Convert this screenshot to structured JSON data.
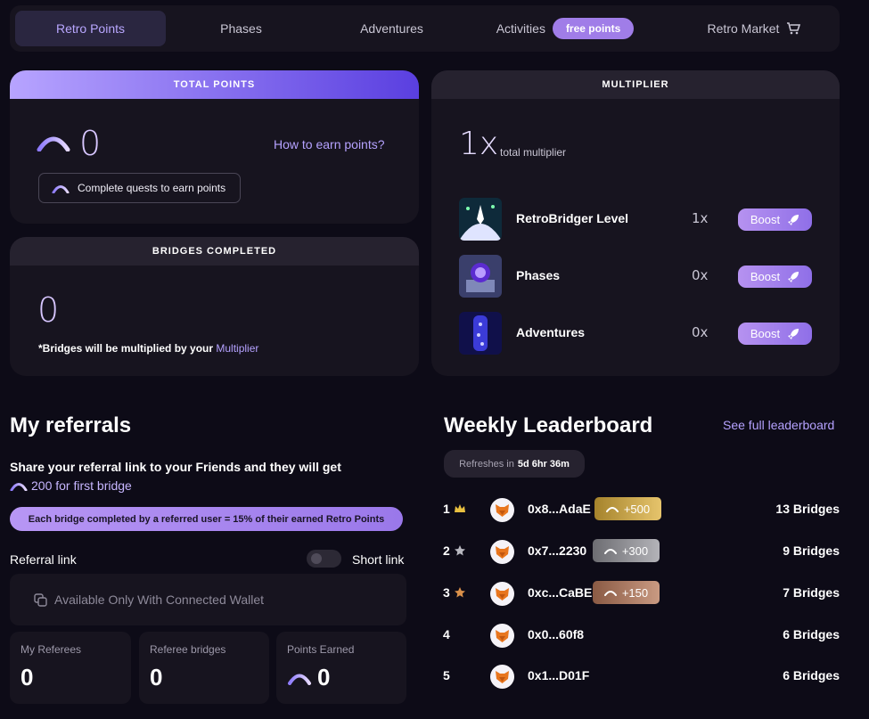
{
  "nav": {
    "items": [
      {
        "label": "Retro Points",
        "active": true
      },
      {
        "label": "Phases"
      },
      {
        "label": "Adventures"
      },
      {
        "label": "Activities",
        "pill": "free points"
      },
      {
        "label": "Retro Market",
        "icon": "cart-icon"
      }
    ]
  },
  "total_points": {
    "header": "TOTAL POINTS",
    "value": "0",
    "how_to_earn": "How to earn points?",
    "quest_button": "Complete quests to earn points"
  },
  "bridges_completed": {
    "header": "BRIDGES COMPLETED",
    "value": "0",
    "note_prefix": "*Bridges will be multiplied by your ",
    "note_link": "Multiplier"
  },
  "multiplier": {
    "header": "MULTIPLIER",
    "value": "1x",
    "label": "total multiplier",
    "rows": [
      {
        "name": "RetroBridger Level",
        "value": "1x",
        "button": "Boost"
      },
      {
        "name": "Phases",
        "value": "0x",
        "button": "Boost"
      },
      {
        "name": "Adventures",
        "value": "0x",
        "button": "Boost"
      }
    ]
  },
  "referrals": {
    "title": "My referrals",
    "share_text": "Share your referral link to your Friends and they will get",
    "bonus_text": "200 for first bridge",
    "banner": "Each bridge completed by a referred user = 15% of their earned Retro Points",
    "link_label": "Referral link",
    "short_link_label": "Short link",
    "wallet_text": "Available Only With Connected Wallet",
    "stats": [
      {
        "label": "My Referees",
        "value": "0"
      },
      {
        "label": "Referee bridges",
        "value": "0"
      },
      {
        "label": "Points Earned",
        "value": "0"
      }
    ]
  },
  "leaderboard": {
    "title": "Weekly Leaderboard",
    "see_full": "See full leaderboard",
    "refresh_label": "Refreshes in",
    "refresh_time": "5d 6hr 36m",
    "rows": [
      {
        "rank": "1",
        "address": "0x8...AdaE",
        "points": "+500",
        "bridges": "13 Bridges",
        "tier": "gold"
      },
      {
        "rank": "2",
        "address": "0x7...2230",
        "points": "+300",
        "bridges": "9 Bridges",
        "tier": "silver"
      },
      {
        "rank": "3",
        "address": "0xc...CaBE",
        "points": "+150",
        "bridges": "7 Bridges",
        "tier": "bronze"
      },
      {
        "rank": "4",
        "address": "0x0...60f8",
        "bridges": "6 Bridges"
      },
      {
        "rank": "5",
        "address": "0x1...D01F",
        "bridges": "6 Bridges"
      }
    ]
  },
  "colors": {
    "accent": "#a07de8",
    "background": "#0d0b17",
    "card": "#17141f",
    "gold": "#d8b45a",
    "silver": "#9a9a9a",
    "bronze": "#b07a5e"
  }
}
